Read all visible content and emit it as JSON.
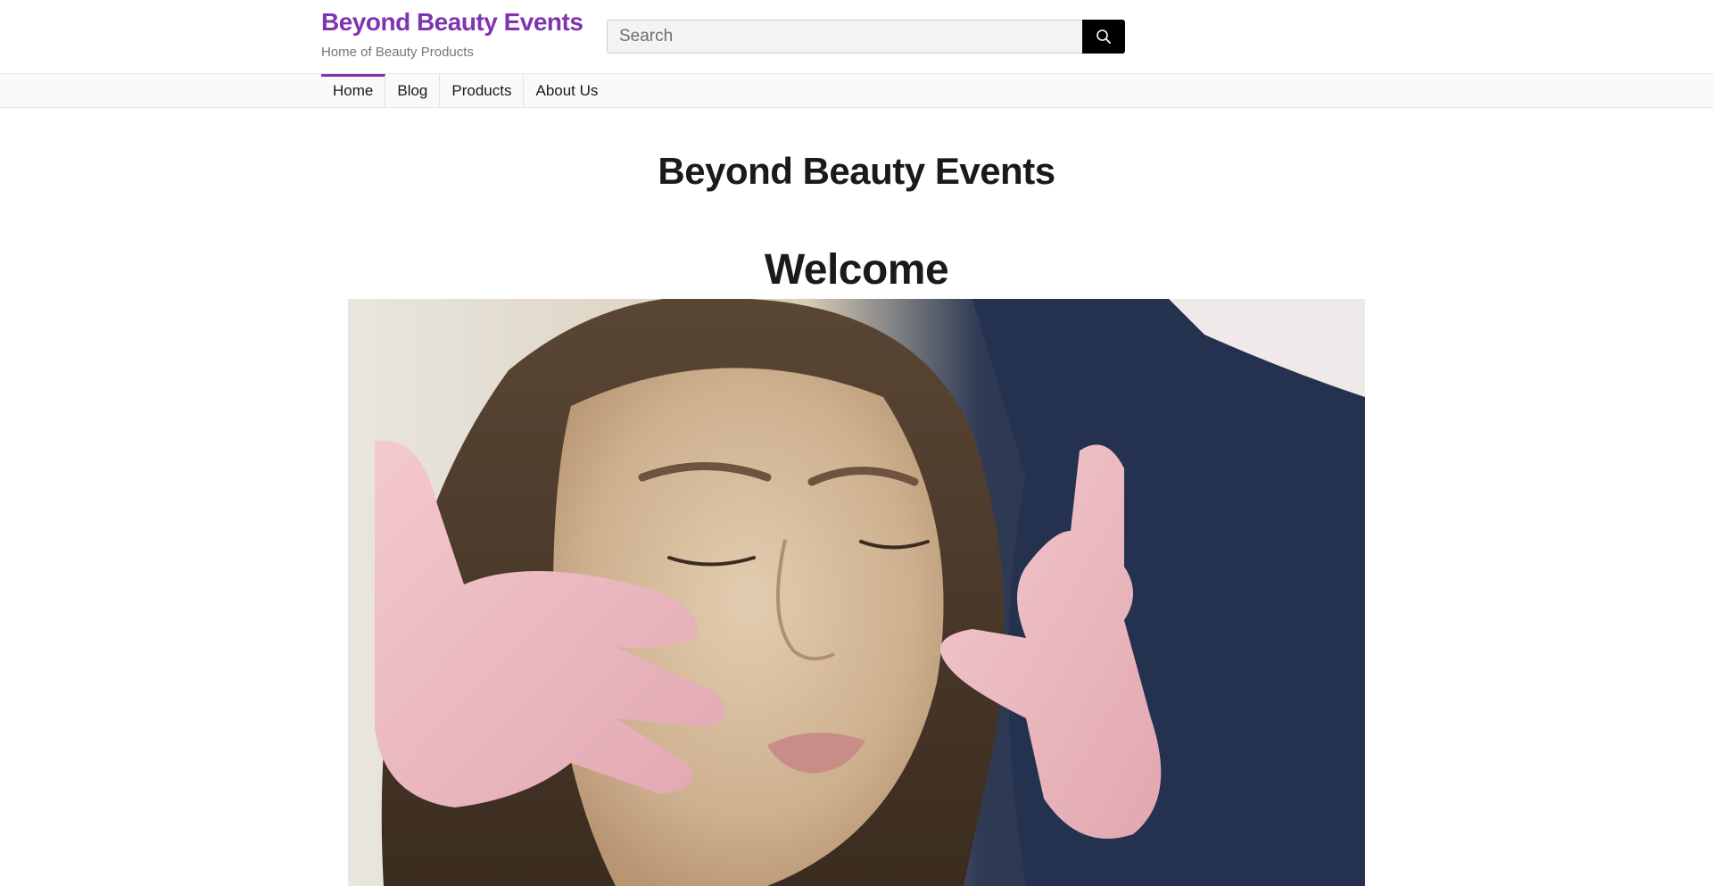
{
  "header": {
    "site_title": "Beyond Beauty Events",
    "tagline": "Home of Beauty Products",
    "brand_color": "#7f35b2"
  },
  "search": {
    "placeholder": "Search",
    "value": "",
    "button_icon": "search-icon"
  },
  "nav": {
    "items": [
      {
        "label": "Home",
        "active": true
      },
      {
        "label": "Blog",
        "active": false
      },
      {
        "label": "Products",
        "active": false
      },
      {
        "label": "About Us",
        "active": false
      }
    ]
  },
  "main": {
    "page_heading": "Beyond Beauty Events",
    "welcome_heading": "Welcome",
    "hero_image": {
      "subject": "woman receiving facial treatment from gloved hands"
    }
  }
}
